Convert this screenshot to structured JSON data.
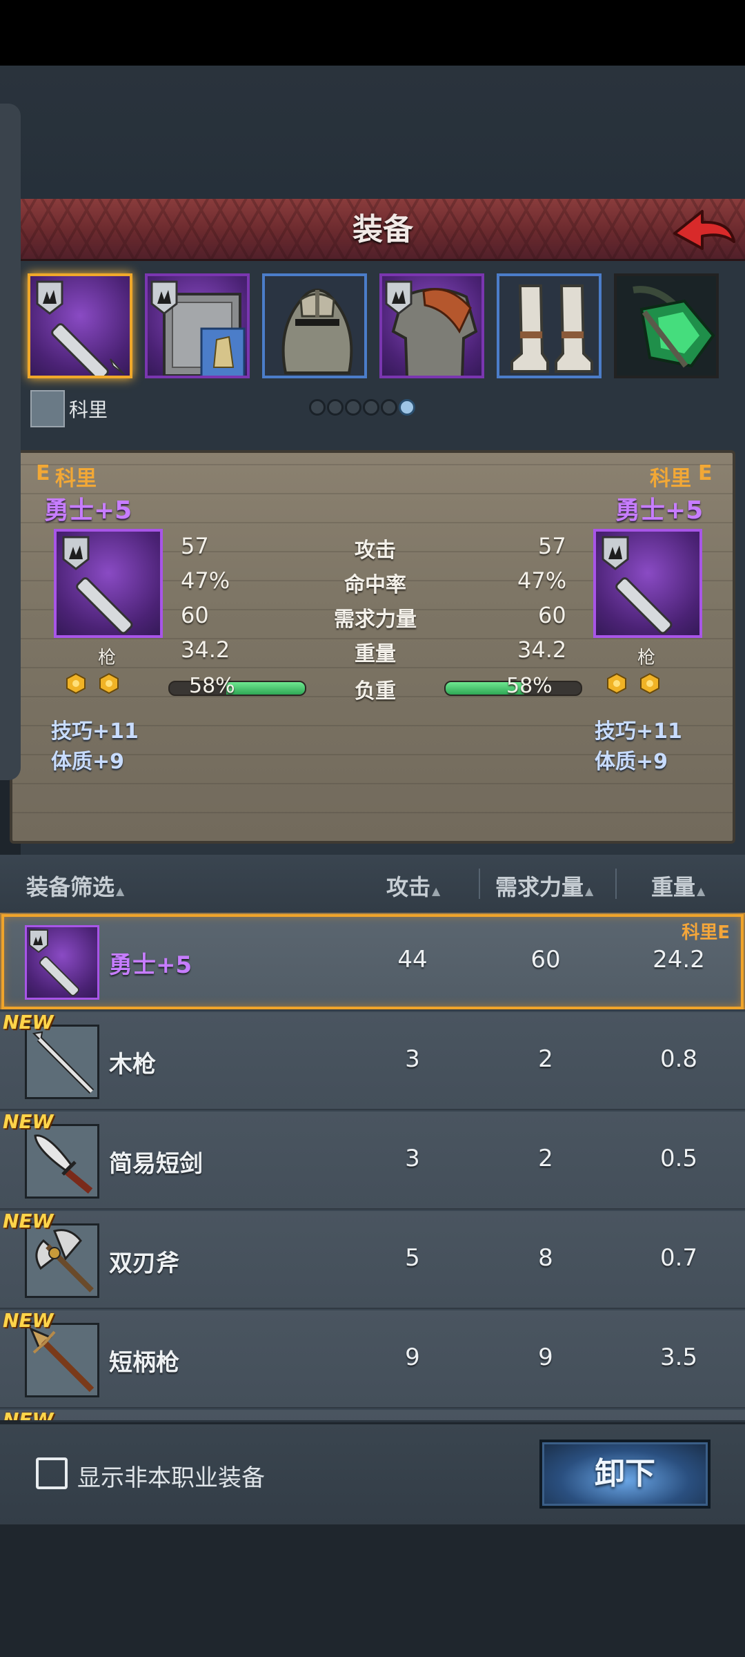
{
  "header": {
    "title": "装备"
  },
  "hero": {
    "name": "科里"
  },
  "pager": {
    "count": 6,
    "active_index": 5
  },
  "comparison": {
    "left": {
      "rank": "E",
      "owner": "科里",
      "name": "勇士+5",
      "type": "枪",
      "bonuses": [
        "技巧+11",
        "体质+9"
      ],
      "stats": {
        "attack": "57",
        "hit": "47%",
        "str_req": "60",
        "weight": "34.2"
      },
      "load_percent": 58,
      "load_text": "58%"
    },
    "right": {
      "rank": "E",
      "owner": "科里",
      "name": "勇士+5",
      "type": "枪",
      "bonuses": [
        "技巧+11",
        "体质+9"
      ],
      "stats": {
        "attack": "57",
        "hit": "47%",
        "str_req": "60",
        "weight": "34.2"
      },
      "load_percent": 58,
      "load_text": "58%"
    },
    "labels": {
      "attack": "攻击",
      "hit": "命中率",
      "str_req": "需求力量",
      "weight": "重量",
      "load": "负重"
    }
  },
  "list_header": {
    "filter": "装备筛选",
    "attack": "攻击",
    "str_req": "需求力量",
    "weight": "重量",
    "arrow": "▲"
  },
  "items": [
    {
      "name": "勇士+5",
      "attack": "44",
      "str_req": "60",
      "weight": "24.2",
      "new": false,
      "selected": true,
      "equipped_label": "科里E"
    },
    {
      "name": "木枪",
      "attack": "3",
      "str_req": "2",
      "weight": "0.8",
      "new": true,
      "new_label": "NEW"
    },
    {
      "name": "简易短剑",
      "attack": "3",
      "str_req": "2",
      "weight": "0.5",
      "new": true,
      "new_label": "NEW"
    },
    {
      "name": "双刃斧",
      "attack": "5",
      "str_req": "8",
      "weight": "0.7",
      "new": true,
      "new_label": "NEW"
    },
    {
      "name": "短柄枪",
      "attack": "9",
      "str_req": "9",
      "weight": "3.5",
      "new": true,
      "new_label": "NEW"
    },
    {
      "new": true,
      "new_label": "NEW"
    }
  ],
  "footer": {
    "checkbox_label": "显示非本职业装备",
    "checked": false,
    "unequip_label": "卸下"
  },
  "colors": {
    "accent_gold": "#f0a82a",
    "epic_purple": "#a855e8",
    "header_red": "#7a3034",
    "load_green": "#3fbf63"
  },
  "icons": {
    "slots": [
      "spear-icon",
      "shield-icon",
      "helmet-icon",
      "armor-icon",
      "boots-icon",
      "gem-icon"
    ],
    "back": "back-arrow-icon"
  }
}
